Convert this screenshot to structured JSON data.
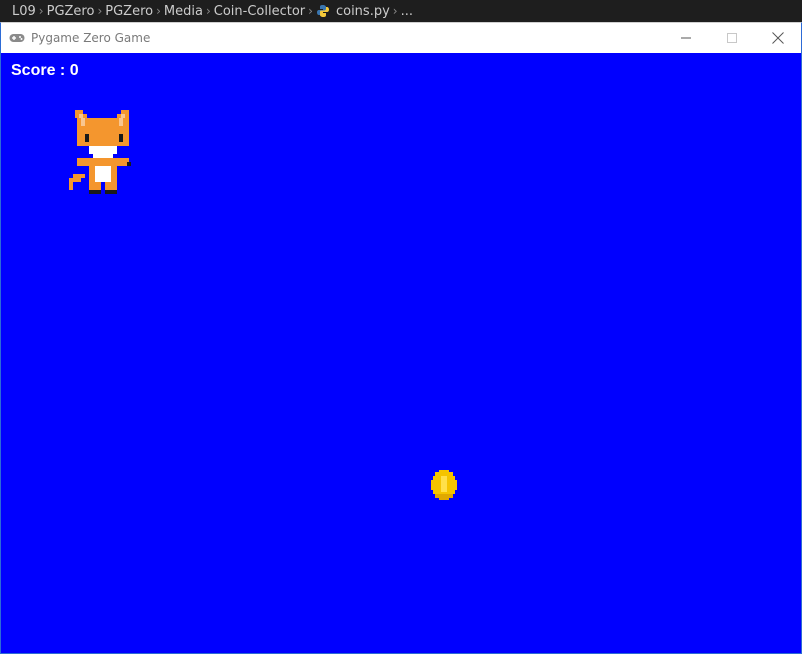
{
  "breadcrumb": {
    "items": [
      "L09",
      "PGZero",
      "PGZero",
      "Media",
      "Coin-Collector",
      "coins.py",
      "..."
    ]
  },
  "window": {
    "title": "Pygame Zero Game"
  },
  "game": {
    "background_color": "#0000ff",
    "score_label": "Score : 0",
    "player_sprite": "fox-sprite",
    "coin_sprite": "coin-sprite"
  }
}
